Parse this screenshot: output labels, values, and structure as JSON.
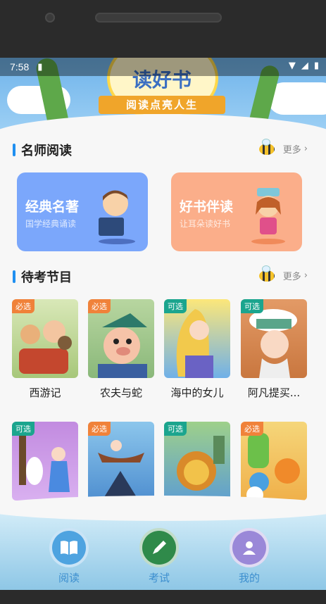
{
  "status": {
    "time": "7:58"
  },
  "banner": {
    "title": "读好书",
    "slogan": "阅读点亮人生"
  },
  "sections": {
    "teachers": {
      "title": "名师阅读",
      "more": "更多"
    },
    "exam": {
      "title": "待考节目",
      "more": "更多"
    }
  },
  "cards": [
    {
      "title": "经典名著",
      "subtitle": "国学经典诵读",
      "color": "#7ba7fb"
    },
    {
      "title": "好书伴读",
      "subtitle": "让耳朵读好书",
      "color": "#fbae8a"
    }
  ],
  "tags": {
    "must": "必选",
    "optional": "可选"
  },
  "books": [
    {
      "title": "西游记",
      "tag": "必选"
    },
    {
      "title": "农夫与蛇",
      "tag": "必选"
    },
    {
      "title": "海中的女儿",
      "tag": "可选"
    },
    {
      "title": "阿凡提买...",
      "tag": "可选"
    },
    {
      "title": "",
      "tag": "可选"
    },
    {
      "title": "",
      "tag": "必选"
    },
    {
      "title": "",
      "tag": "可选"
    },
    {
      "title": "",
      "tag": "必选"
    }
  ],
  "tabs": [
    {
      "label": "阅读",
      "icon": "book-icon"
    },
    {
      "label": "考试",
      "icon": "pen-icon"
    },
    {
      "label": "我的",
      "icon": "user-icon"
    }
  ],
  "colors": {
    "accent": "#1f8ff0",
    "must_tag": "#f0823a",
    "optional_tag": "#1ba58e"
  }
}
